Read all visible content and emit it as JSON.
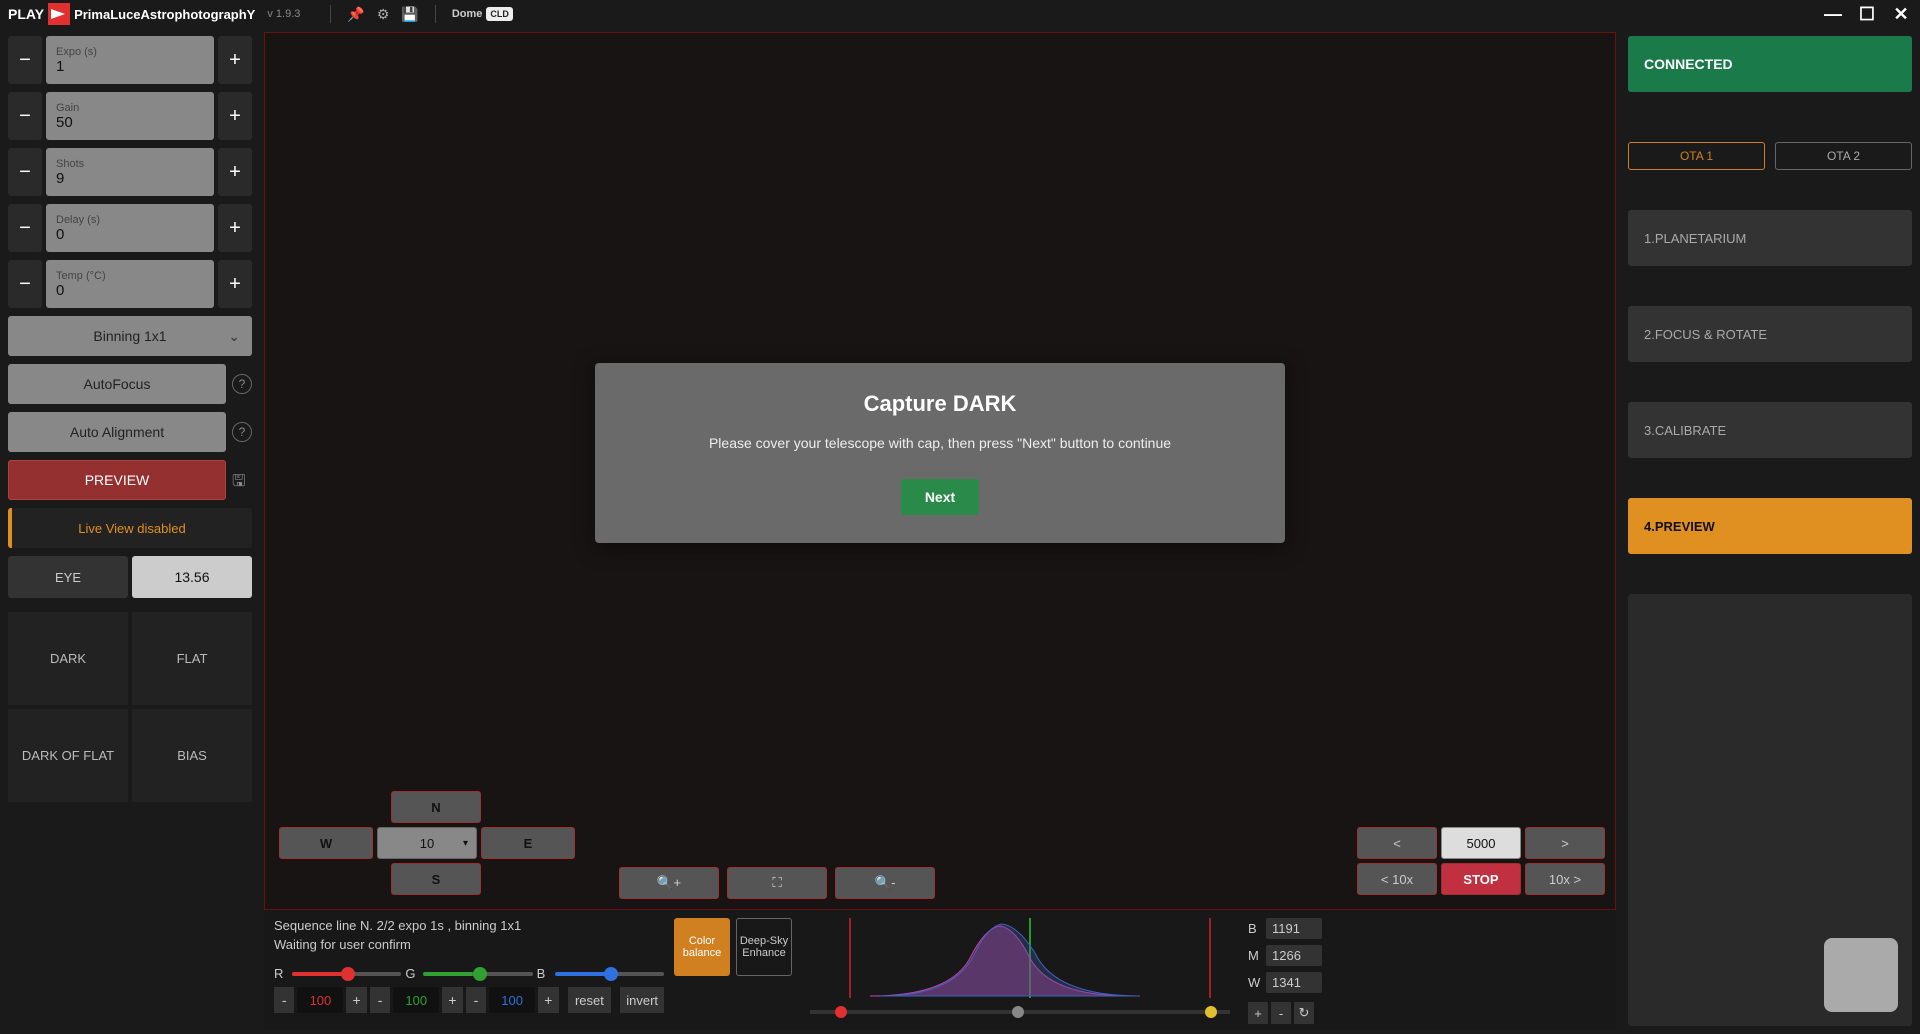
{
  "titlebar": {
    "play": "PLAY",
    "app_name": "PrimaLuceAstrophotographY",
    "version": "v 1.9.3",
    "dome": "Dome",
    "cld": "CLD"
  },
  "left": {
    "expo": {
      "label": "Expo (s)",
      "value": "1"
    },
    "gain": {
      "label": "Gain",
      "value": "50"
    },
    "shots": {
      "label": "Shots",
      "value": "9"
    },
    "delay": {
      "label": "Delay (s)",
      "value": "0"
    },
    "temp": {
      "label": "Temp (°C)",
      "value": "0"
    },
    "binning": "Binning 1x1",
    "autofocus": "AutoFocus",
    "autoalign": "Auto Alignment",
    "preview": "PREVIEW",
    "liveview": "Live View disabled",
    "eye_label": "EYE",
    "eye_value": "13.56",
    "dark": "DARK",
    "flat": "FLAT",
    "darkflat": "DARK OF FLAT",
    "bias": "BIAS"
  },
  "modal": {
    "title": "Capture DARK",
    "text": "Please cover your telescope with cap, then press \"Next\" button to continue",
    "next": "Next"
  },
  "dir": {
    "n": "N",
    "s": "S",
    "e": "E",
    "w": "W",
    "speed": "10"
  },
  "rc": {
    "lt": "<",
    "gt": ">",
    "val": "5000",
    "lt10": "< 10x",
    "stop": "STOP",
    "gt10": "10x >"
  },
  "bottom": {
    "seq1": "Sequence line N. 2/2 expo 1s , binning 1x1",
    "seq2": "Waiting for user confirm",
    "r_label": "R",
    "g_label": "G",
    "b_label": "B",
    "r_val": "100",
    "g_val": "100",
    "b_val": "100",
    "reset": "reset",
    "invert": "invert",
    "color_balance": "Color balance",
    "deep_sky": "Deep-Sky Enhance",
    "bmw_b_label": "B",
    "bmw_b": "1191",
    "bmw_m_label": "M",
    "bmw_m": "1266",
    "bmw_w_label": "W",
    "bmw_w": "1341",
    "plus": "+",
    "minus": "-",
    "reload": "↻"
  },
  "right": {
    "connected": "CONNECTED",
    "ota1": "OTA 1",
    "ota2": "OTA 2",
    "step1": "1.PLANETARIUM",
    "step2": "2.FOCUS & ROTATE",
    "step3": "3.CALIBRATE",
    "step4": "4.PREVIEW"
  }
}
